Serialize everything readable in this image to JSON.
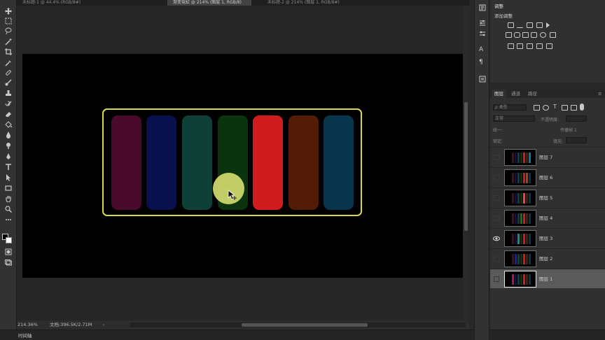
{
  "tabs": [
    {
      "label": "未标题-1 @ 44.4% (RGB/8#)"
    },
    {
      "label": "渐变霓虹 @ 214% (图层 1, RGB/8)"
    },
    {
      "label": "未标题-2 @ 214% (图层 1, RGB/8#)"
    }
  ],
  "adjustments": {
    "title": "调整",
    "subtitle": "添加调整"
  },
  "layers_panel": {
    "tabs": [
      "图层",
      "通道",
      "路径"
    ],
    "filter_kind": "ρ 类型",
    "blend_mode": "正常",
    "opacity_label": "不透明度:",
    "opacity_value": "",
    "lock_label": "锁定:",
    "fill_label": "填充:",
    "unify_label": "统一:",
    "propagate_label": "传播帧 1",
    "layers": [
      {
        "name": "图层 7",
        "visible": false,
        "selected": false
      },
      {
        "name": "图层 6",
        "visible": false,
        "selected": false
      },
      {
        "name": "图层 5",
        "visible": false,
        "selected": false
      },
      {
        "name": "图层 4",
        "visible": false,
        "selected": false
      },
      {
        "name": "图层 3",
        "visible": true,
        "selected": false
      },
      {
        "name": "图层 2",
        "visible": false,
        "selected": false
      },
      {
        "name": "图层 1",
        "visible": false,
        "selected": true
      }
    ]
  },
  "status": {
    "zoom": "214.36%",
    "doc": "文档:396.5K/2.71M"
  },
  "timeline": {
    "label": "时间轴"
  },
  "canvas_bars": {
    "colors": [
      "#4a0a2b",
      "#08104d",
      "#0f4038",
      "#0b330d",
      "#d01c1f",
      "#521c09",
      "#08354b"
    ]
  },
  "colors": {
    "selection_frame": "#d8d84a",
    "cursor_highlight": "#d2da6e",
    "bg_canvas": "#000000"
  }
}
